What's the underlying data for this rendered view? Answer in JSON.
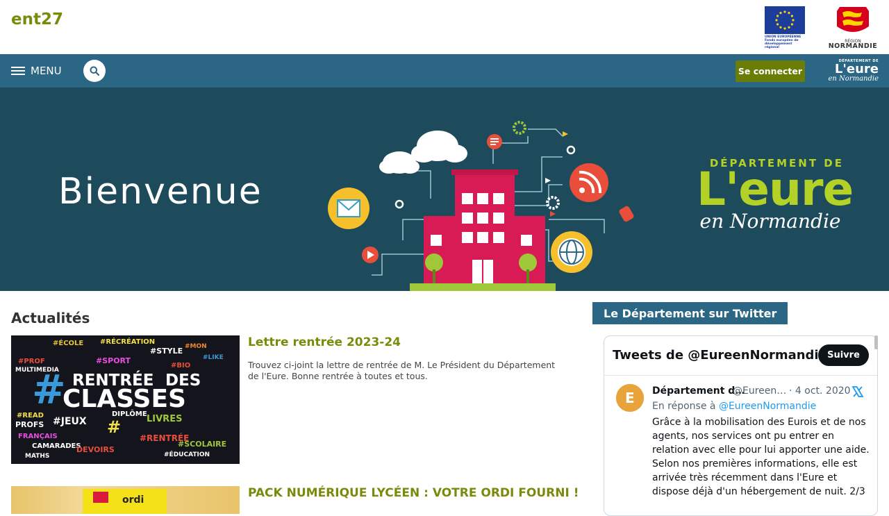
{
  "header": {
    "site_title": "ent27",
    "eu_logo_caption": "UNION EUROPÉENNE Fonds européen de développement régional",
    "normandie_logo_top": "RÉGION",
    "normandie_logo_bottom": "NORMANDIE"
  },
  "nav": {
    "menu_label": "MENU",
    "search_icon": "search-icon",
    "connect_label": "Se connecter",
    "dept_logo_top": "DÉPARTEMENT DE",
    "dept_logo_mid": "L'eure",
    "dept_logo_bot": "en Normandie"
  },
  "banner": {
    "title": "Bienvenue",
    "logo_top": "DÉPARTEMENT DE",
    "logo_mid": "L'eure",
    "logo_bot": "en Normandie"
  },
  "news": {
    "section_title": "Actualités",
    "items": [
      {
        "title": "Lettre rentrée 2023-24",
        "description": "Trouvez ci-joint la lettre de rentrée de M. Le Président du Département de l'Eure. Bonne rentrée à toutes et tous.",
        "thumb_text_1": "#RENTRÉE DES",
        "thumb_text_2": "#CLASSES"
      },
      {
        "title": "PACK NUMÉRIQUE LYCÉEN : VOTRE ORDI FOURNI !",
        "description": ""
      }
    ]
  },
  "twitter": {
    "section_title": "Le Département sur Twitter",
    "widget_title": "Tweets de @EureenNormandie",
    "follow_label": "Suivre",
    "tweet": {
      "name": "Département d…",
      "handle": "@Eureen…",
      "date": "· 4 oct. 2020",
      "reply_prefix": "En réponse à",
      "reply_handle": "@EureenNormandie",
      "text": "Grâce à la mobilisation des Eurois et de nos agents, nos services ont pu entrer en relation avec elle pour lui apporter une aide. Selon nos premières informations, elle est arrivée très récemment dans l'Eure et dispose déjà d'un hébergement de nuit. 2/3"
    }
  },
  "colors": {
    "brand_green": "#7a8a0b",
    "nav_blue": "#2b6684",
    "banner_bg": "#1d4b5c",
    "button_green": "#6a7d06"
  }
}
